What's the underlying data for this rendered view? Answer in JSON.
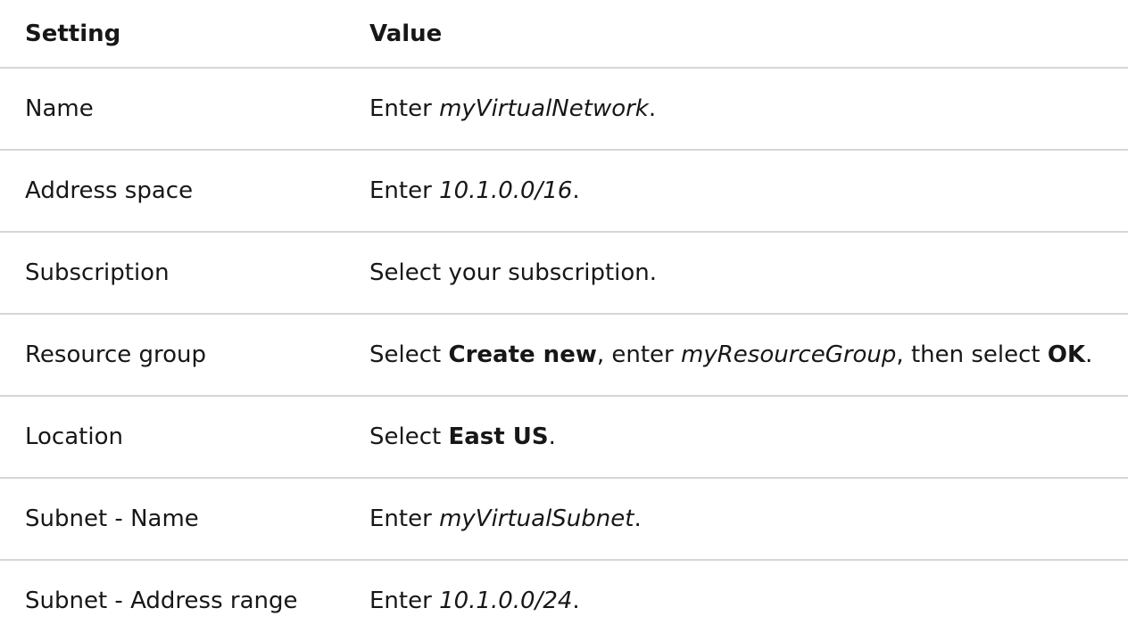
{
  "table": {
    "headers": [
      "Setting",
      "Value"
    ],
    "rows": [
      {
        "setting": "Name",
        "value": [
          {
            "text": "Enter "
          },
          {
            "text": "myVirtualNetwork",
            "style": "italic"
          },
          {
            "text": "."
          }
        ]
      },
      {
        "setting": "Address space",
        "value": [
          {
            "text": "Enter "
          },
          {
            "text": "10.1.0.0/16",
            "style": "italic"
          },
          {
            "text": "."
          }
        ]
      },
      {
        "setting": "Subscription",
        "value": [
          {
            "text": "Select your subscription."
          }
        ]
      },
      {
        "setting": "Resource group",
        "value": [
          {
            "text": "Select "
          },
          {
            "text": "Create new",
            "style": "bold"
          },
          {
            "text": ", enter "
          },
          {
            "text": "myResourceGroup",
            "style": "italic"
          },
          {
            "text": ", then select "
          },
          {
            "text": "OK",
            "style": "bold"
          },
          {
            "text": "."
          }
        ]
      },
      {
        "setting": "Location",
        "value": [
          {
            "text": "Select "
          },
          {
            "text": "East US",
            "style": "bold"
          },
          {
            "text": "."
          }
        ]
      },
      {
        "setting": "Subnet - Name",
        "value": [
          {
            "text": "Enter "
          },
          {
            "text": "myVirtualSubnet",
            "style": "italic"
          },
          {
            "text": "."
          }
        ]
      },
      {
        "setting": "Subnet - Address range",
        "value": [
          {
            "text": "Enter "
          },
          {
            "text": "10.1.0.0/24",
            "style": "italic"
          },
          {
            "text": "."
          }
        ]
      }
    ]
  }
}
